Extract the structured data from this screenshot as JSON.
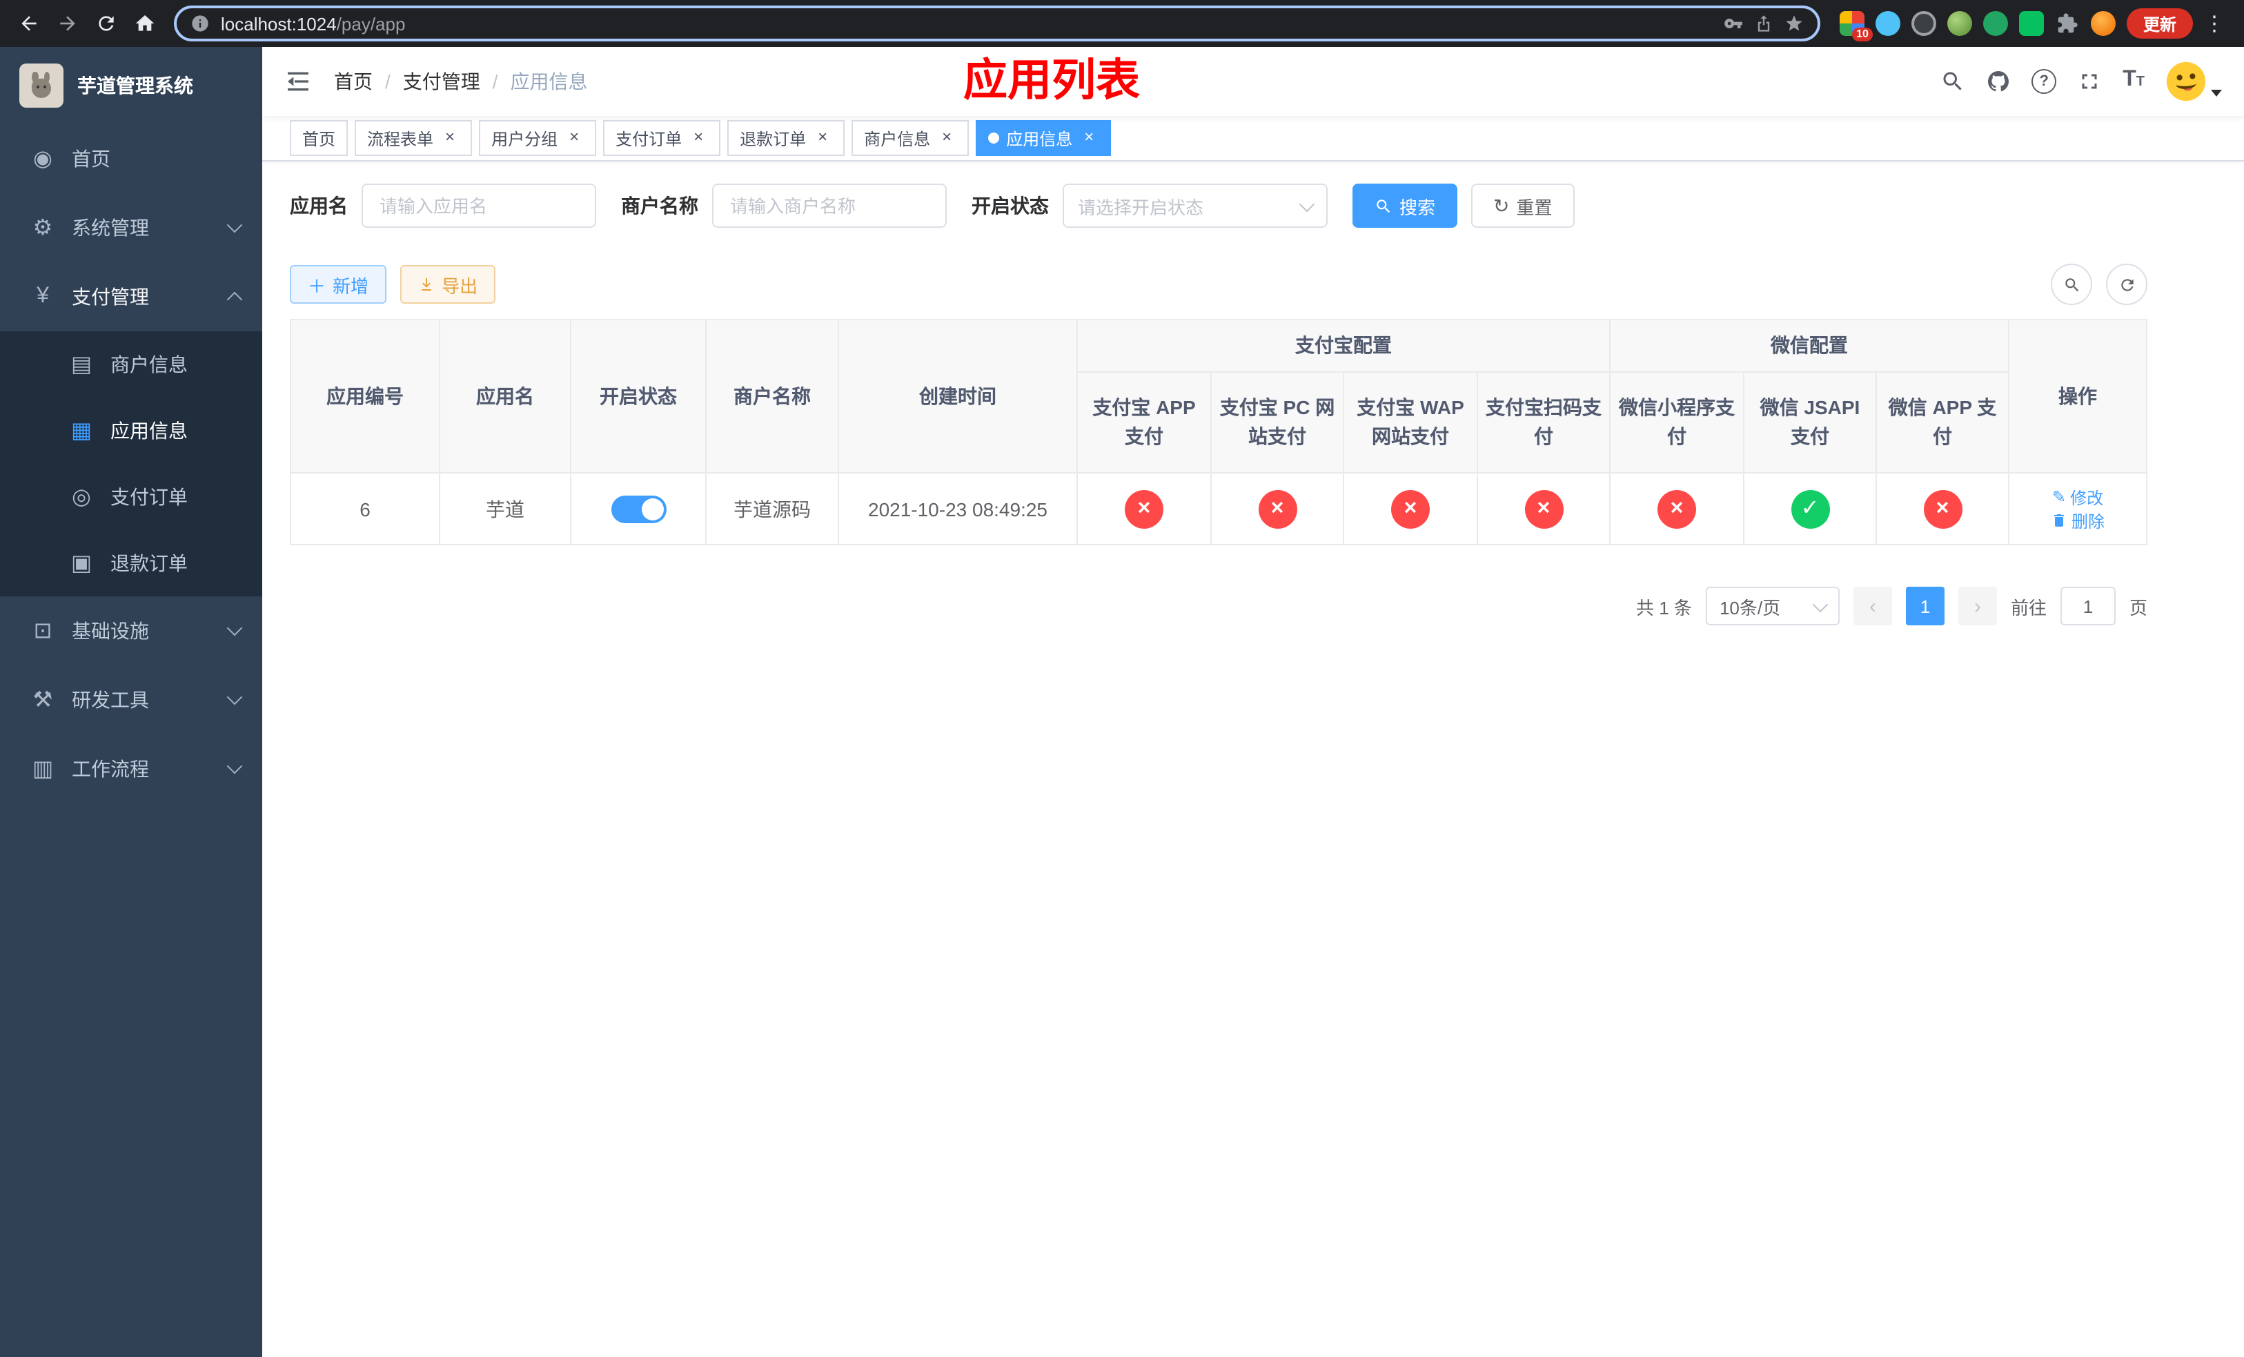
{
  "browser": {
    "url_domain": "localhost:1024",
    "url_path": "/pay/app",
    "extension_badge": "10",
    "update_label": "更新"
  },
  "sidebar": {
    "app_title": "芋道管理系统",
    "menu": [
      {
        "label": "首页"
      },
      {
        "label": "系统管理"
      },
      {
        "label": "支付管理"
      },
      {
        "label": "基础设施"
      },
      {
        "label": "研发工具"
      },
      {
        "label": "工作流程"
      }
    ],
    "pay_submenu": [
      {
        "label": "商户信息"
      },
      {
        "label": "应用信息"
      },
      {
        "label": "支付订单"
      },
      {
        "label": "退款订单"
      }
    ]
  },
  "breadcrumb": {
    "items": [
      "首页",
      "支付管理",
      "应用信息"
    ],
    "separator": "/"
  },
  "annotation": "应用列表",
  "tabs": [
    {
      "label": "首页"
    },
    {
      "label": "流程表单"
    },
    {
      "label": "用户分组"
    },
    {
      "label": "支付订单"
    },
    {
      "label": "退款订单"
    },
    {
      "label": "商户信息"
    },
    {
      "label": "应用信息"
    }
  ],
  "search_form": {
    "app_name_label": "应用名",
    "app_name_placeholder": "请输入应用名",
    "merchant_label": "商户名称",
    "merchant_placeholder": "请输入商户名称",
    "status_label": "开启状态",
    "status_placeholder": "请选择开启状态",
    "search_button": "搜索",
    "reset_button": "重置"
  },
  "toolbar": {
    "add_label": "新增",
    "export_label": "导出"
  },
  "table": {
    "group_headers": {
      "alipay": "支付宝配置",
      "wechat": "微信配置"
    },
    "columns": {
      "app_id": "应用编号",
      "app_name": "应用名",
      "status": "开启状态",
      "merchant": "商户名称",
      "created": "创建时间",
      "alipay_app": "支付宝 APP 支付",
      "alipay_pc": "支付宝 PC 网站支付",
      "alipay_wap": "支付宝 WAP 网站支付",
      "alipay_qr": "支付宝扫码支付",
      "wechat_mini": "微信小程序支付",
      "wechat_jsapi": "微信 JSAPI 支付",
      "wechat_app": "微信 APP 支付",
      "actions": "操作"
    },
    "rows": [
      {
        "app_id": "6",
        "app_name": "芋道",
        "status_on": true,
        "merchant": "芋道源码",
        "created": "2021-10-23 08:49:25",
        "configs": [
          "no",
          "no",
          "no",
          "no",
          "no",
          "yes",
          "no"
        ],
        "edit_label": "修改",
        "delete_label": "删除"
      }
    ]
  },
  "pagination": {
    "total": "共 1 条",
    "page_size": "10条/页",
    "page": "1",
    "goto_prefix": "前往",
    "goto_value": "1",
    "goto_suffix": "页"
  },
  "colors": {
    "primary": "#409eff",
    "success": "#13ce66",
    "danger": "#ff4949",
    "warning": "#e6a23c",
    "annotation_red": "#ff0000",
    "sidebar_bg": "#304156",
    "submenu_bg": "#1f2d3d"
  }
}
